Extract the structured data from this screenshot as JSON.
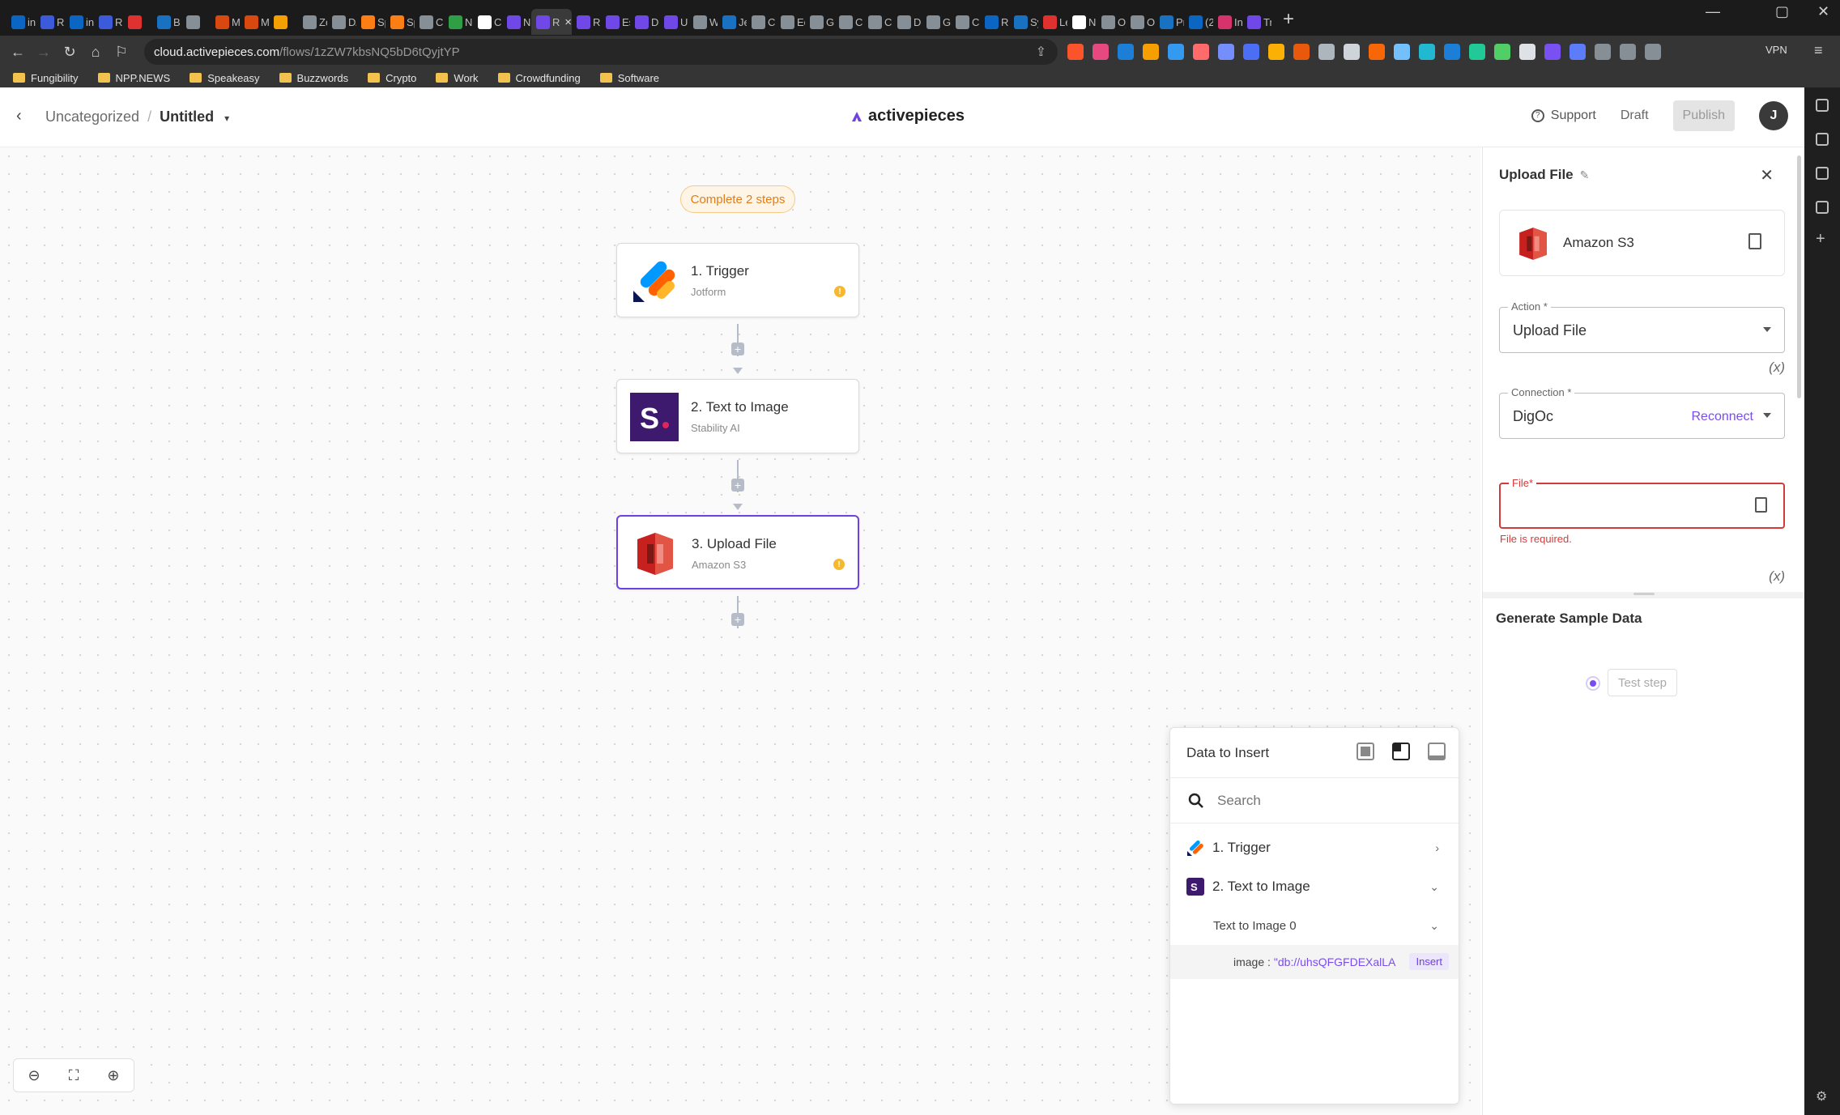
{
  "browser": {
    "tabs": [
      {
        "title": "in",
        "color": "#0a66c2"
      },
      {
        "title": "R",
        "color": "#3b5bdb"
      },
      {
        "title": "in",
        "color": "#0a66c2"
      },
      {
        "title": "R",
        "color": "#3b5bdb"
      },
      {
        "title": "",
        "color": "#e03131"
      },
      {
        "title": "B",
        "color": "#1971c2"
      },
      {
        "title": "",
        "color": "#868e96"
      },
      {
        "title": "M",
        "color": "#d9480f"
      },
      {
        "title": "M",
        "color": "#d9480f"
      },
      {
        "title": "",
        "color": "#f59f00"
      },
      {
        "title": "Zo",
        "color": "#868e96"
      },
      {
        "title": "D/",
        "color": "#868e96"
      },
      {
        "title": "Sp",
        "color": "#fd7e14"
      },
      {
        "title": "Sp",
        "color": "#fd7e14"
      },
      {
        "title": "Ch",
        "color": "#868e96"
      },
      {
        "title": "N",
        "color": "#2f9e44"
      },
      {
        "title": "Ch",
        "color": "#ffffff"
      },
      {
        "title": "Ne",
        "color": "#7048e8"
      },
      {
        "title": "Ru",
        "color": "#7048e8"
      },
      {
        "title": "Ru",
        "color": "#7048e8"
      },
      {
        "title": "Es",
        "color": "#7048e8"
      },
      {
        "title": "Di",
        "color": "#7048e8"
      },
      {
        "title": "Un",
        "color": "#7048e8"
      },
      {
        "title": "W",
        "color": "#868e96"
      },
      {
        "title": "Jet",
        "color": "#1971c2"
      },
      {
        "title": "Cl",
        "color": "#868e96"
      },
      {
        "title": "Ed",
        "color": "#868e96"
      },
      {
        "title": "Ge",
        "color": "#868e96"
      },
      {
        "title": "Cl",
        "color": "#868e96"
      },
      {
        "title": "Cl",
        "color": "#868e96"
      },
      {
        "title": "Da",
        "color": "#868e96"
      },
      {
        "title": "Gc",
        "color": "#868e96"
      },
      {
        "title": "Ca",
        "color": "#868e96"
      },
      {
        "title": "Ru",
        "color": "#0a66c2"
      },
      {
        "title": "Sy",
        "color": "#1971c2"
      },
      {
        "title": "Le",
        "color": "#e03131"
      },
      {
        "title": "Ne",
        "color": "#ffffff"
      },
      {
        "title": "Oj",
        "color": "#868e96"
      },
      {
        "title": "Op",
        "color": "#868e96"
      },
      {
        "title": "Pr",
        "color": "#1971c2"
      },
      {
        "title": "(2",
        "color": "#0a66c2"
      },
      {
        "title": "In",
        "color": "#d6336c"
      },
      {
        "title": "Tr",
        "color": "#7048e8"
      }
    ],
    "active_tab_index": 18,
    "url_host": "cloud.activepieces.com",
    "url_path": "/flows/1zZW7kbsNQ5bD6tQyjtYP",
    "vpn_label": "VPN",
    "bookmarks": [
      "Fungibility",
      "NPP.NEWS",
      "Speakeasy",
      "Buzzwords",
      "Crypto",
      "Work",
      "Crowdfunding",
      "Software"
    ]
  },
  "header": {
    "breadcrumb_parent": "Uncategorized",
    "breadcrumb_separator": "/",
    "flow_name": "Untitled",
    "logo_text": "activepieces",
    "support_label": "Support",
    "status_label": "Draft",
    "publish_label": "Publish",
    "avatar_initial": "J"
  },
  "canvas": {
    "banner": "Complete 2 steps",
    "steps": [
      {
        "title": "1. Trigger",
        "subtitle": "Jotform",
        "warning": true
      },
      {
        "title": "2. Text to Image",
        "subtitle": "Stability AI",
        "warning": false
      },
      {
        "title": "3. Upload File",
        "subtitle": "Amazon S3",
        "warning": true
      }
    ],
    "add_symbol": "+",
    "warning_symbol": "!"
  },
  "data_to_insert": {
    "title": "Data to Insert",
    "search_placeholder": "Search",
    "rows": [
      {
        "label": "1. Trigger",
        "expanded": false
      },
      {
        "label": "2. Text to Image",
        "expanded": true
      }
    ],
    "sub_label": "Text to Image 0",
    "item_key": "image :",
    "item_value": "\"db://uhsQFGFDEXalLA",
    "insert_label": "Insert"
  },
  "side_panel": {
    "title": "Upload File",
    "piece_name": "Amazon S3",
    "action_label": "Action *",
    "action_value": "Upload File",
    "fx_label": "(x)",
    "connection_label": "Connection *",
    "connection_value": "DigOc",
    "reconnect_label": "Reconnect",
    "file_label": "File*",
    "file_error": "File is required.",
    "generate_title": "Generate Sample Data",
    "test_label": "Test step"
  },
  "colors": {
    "brand": "#6e41e2",
    "error": "#d53a3a",
    "warning": "#f5b82e"
  }
}
